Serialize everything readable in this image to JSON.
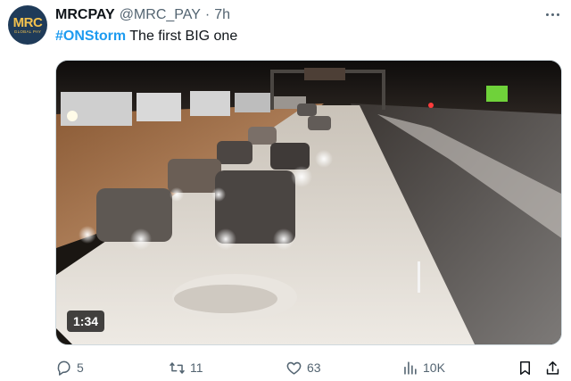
{
  "author": {
    "name": "MRCPAY",
    "handle": "@MRC_PAY",
    "separator": "·",
    "time": "7h",
    "avatar_mark": "MRC",
    "avatar_sub": "GLOBAL PAY"
  },
  "tweet": {
    "hashtag": "#ONStorm",
    "text": " The first BIG one"
  },
  "media": {
    "type": "video",
    "duration": "1:34"
  },
  "actions": {
    "replies": "5",
    "retweets": "11",
    "likes": "63",
    "views": "10K"
  },
  "icons": {
    "more": "more-horizontal-icon",
    "reply": "reply-icon",
    "retweet": "retweet-icon",
    "like": "heart-icon",
    "views": "views-icon",
    "bookmark": "bookmark-icon",
    "share": "share-icon"
  },
  "colors": {
    "link": "#1d9bf0",
    "secondary_text": "#536471",
    "primary_text": "#0f1419",
    "avatar_bg": "#1f3b59",
    "avatar_accent": "#f2c14e"
  }
}
